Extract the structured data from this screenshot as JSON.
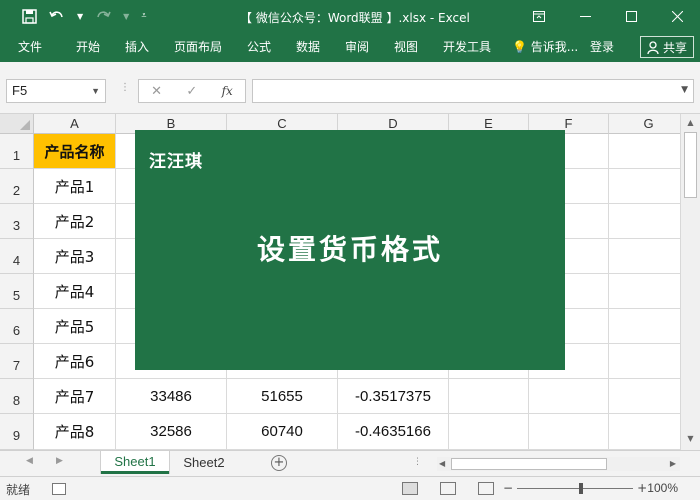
{
  "titlebar": {
    "title": "【 微信公众号：Word联盟 】.xlsx - Excel",
    "save_icon": "save-icon",
    "undo_icon": "undo-icon",
    "redo_icon": "redo-icon",
    "customize_icon": "customize-quick-access-icon",
    "window_buttons": [
      "ribbon-display-options",
      "minimize",
      "restore",
      "close"
    ]
  },
  "ribbon": {
    "tabs": [
      "文件",
      "开始",
      "插入",
      "页面布局",
      "公式",
      "数据",
      "审阅",
      "视图",
      "开发工具"
    ],
    "tell_me": "告诉我...",
    "signin": "登录",
    "share": "共享"
  },
  "formula_bar": {
    "name_box": "F5",
    "cancel_icon": "cancel-icon",
    "enter_icon": "enter-check-icon",
    "fx_label": "fx",
    "formula": ""
  },
  "sheet": {
    "columns": [
      "A",
      "B",
      "C",
      "D",
      "E",
      "F",
      "G"
    ],
    "rows": [
      "1",
      "2",
      "3",
      "4",
      "5",
      "6",
      "7",
      "8",
      "9"
    ],
    "header_cell": "产品名称",
    "header_fill": "#FFC000",
    "products": [
      "产品1",
      "产品2",
      "产品3",
      "产品4",
      "产品5",
      "产品6",
      "产品7",
      "产品8"
    ],
    "row8": [
      "33486",
      "51655",
      "-0.3517375"
    ],
    "row9": [
      "32586",
      "60740",
      "-0.4635166"
    ]
  },
  "overlay": {
    "brand": "汪汪琪",
    "headline": "设置货币格式",
    "background": "#217346"
  },
  "sheet_tabs": {
    "tabs": [
      "Sheet1",
      "Sheet2"
    ],
    "active": "Sheet1",
    "add_icon": "add-sheet-icon"
  },
  "statusbar": {
    "status": "就绪",
    "zoom": "100%",
    "zoom_level": 100
  },
  "theme": {
    "excel_green": "#217346"
  }
}
